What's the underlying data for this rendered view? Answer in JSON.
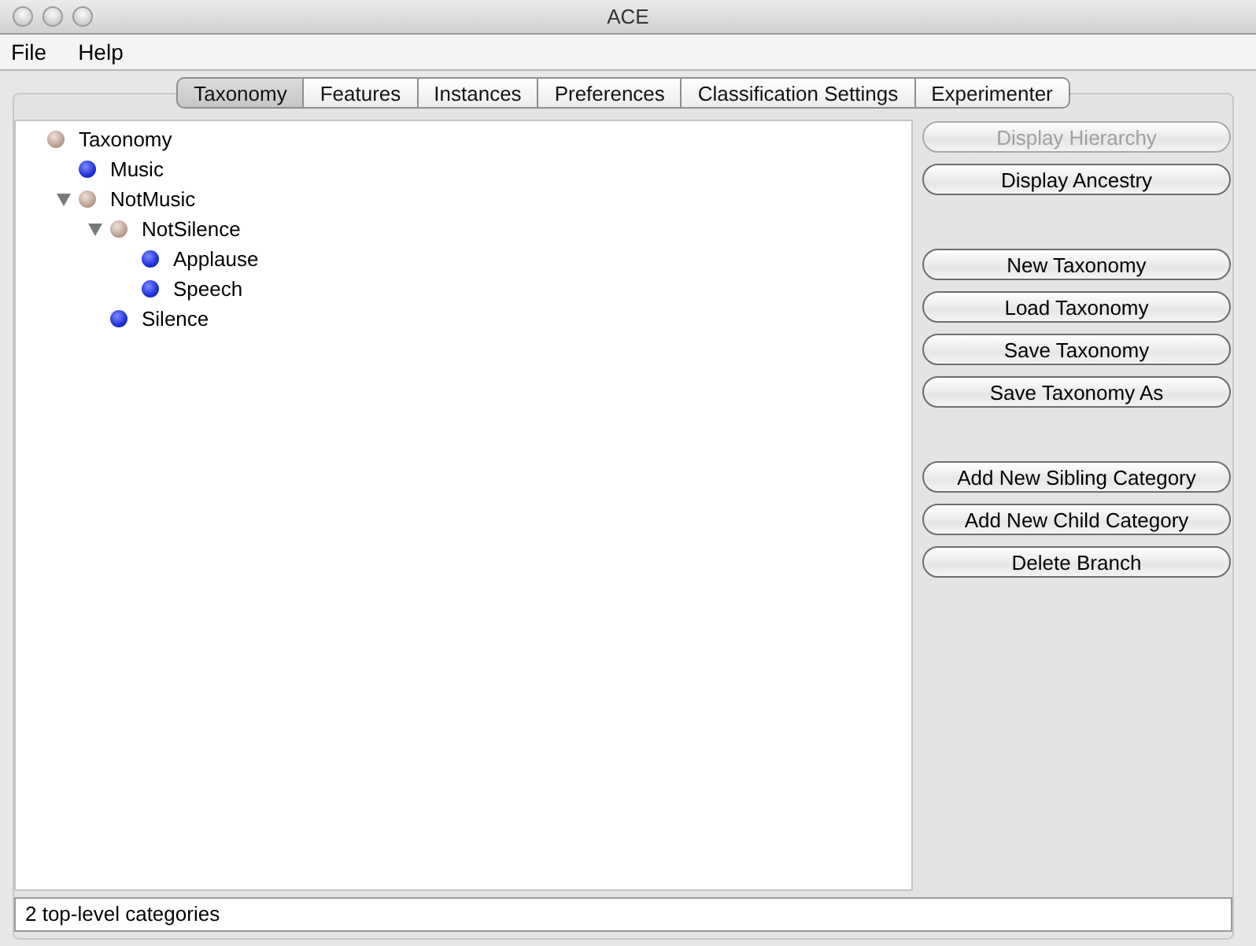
{
  "window": {
    "title": "ACE"
  },
  "menu": [
    "File",
    "Help"
  ],
  "tabs": [
    {
      "label": "Taxonomy",
      "selected": true
    },
    {
      "label": "Features",
      "selected": false
    },
    {
      "label": "Instances",
      "selected": false
    },
    {
      "label": "Preferences",
      "selected": false
    },
    {
      "label": "Classification Settings",
      "selected": false
    },
    {
      "label": "Experimenter",
      "selected": false
    }
  ],
  "tree": {
    "label": "Taxonomy",
    "kind": "branch",
    "children": [
      {
        "label": "Music",
        "kind": "leaf"
      },
      {
        "label": "NotMusic",
        "kind": "branch",
        "expanded": true,
        "children": [
          {
            "label": "NotSilence",
            "kind": "branch",
            "expanded": true,
            "children": [
              {
                "label": "Applause",
                "kind": "leaf"
              },
              {
                "label": "Speech",
                "kind": "leaf"
              }
            ]
          },
          {
            "label": "Silence",
            "kind": "leaf"
          }
        ]
      }
    ]
  },
  "button_groups": [
    [
      {
        "label": "Display Hierarchy",
        "disabled": true
      },
      {
        "label": "Display Ancestry",
        "disabled": false
      }
    ],
    [
      {
        "label": "New Taxonomy",
        "disabled": false
      },
      {
        "label": "Load Taxonomy",
        "disabled": false
      },
      {
        "label": "Save Taxonomy",
        "disabled": false
      },
      {
        "label": "Save Taxonomy As",
        "disabled": false
      }
    ],
    [
      {
        "label": "Add New Sibling Category",
        "disabled": false
      },
      {
        "label": "Add New Child Category",
        "disabled": false
      },
      {
        "label": "Delete Branch",
        "disabled": false
      }
    ]
  ],
  "status": "2 top-level categories"
}
